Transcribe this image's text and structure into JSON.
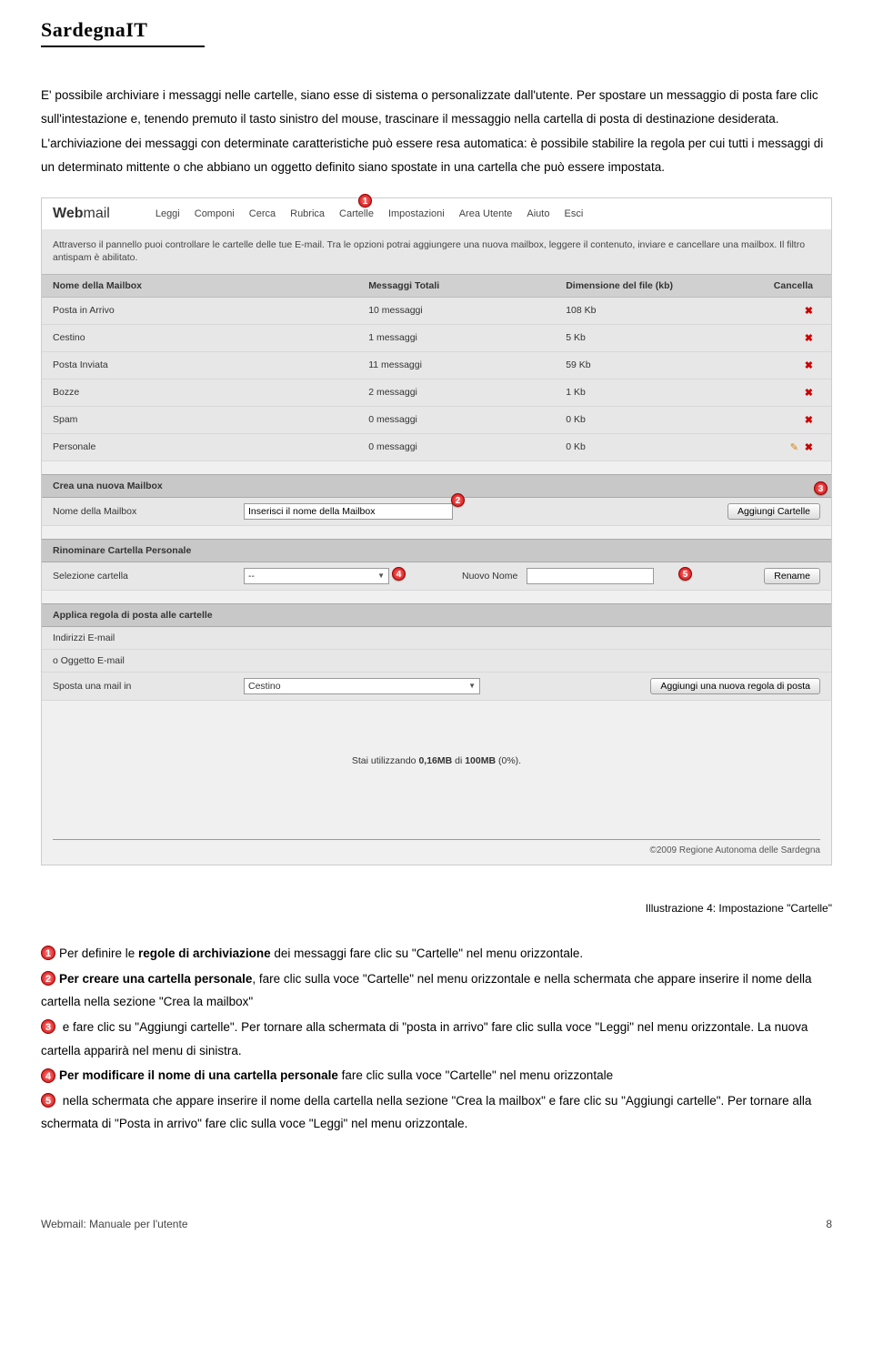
{
  "logo": {
    "brand": "Sardegna",
    "suffix": "IT"
  },
  "intro_paragraphs": [
    "E' possibile archiviare i messaggi nelle cartelle, siano esse di sistema o personalizzate dall'utente. Per spostare un messaggio di posta fare clic sull'intestazione e, tenendo premuto il tasto sinistro del mouse, trascinare il messaggio nella cartella di posta di destinazione desiderata.",
    "L'archiviazione dei messaggi con determinate caratteristiche può essere resa automatica: è possibile stabilire la regola per cui tutti i messaggi di un determinato mittente o che abbiano un oggetto definito siano spostate in una cartella che può essere impostata."
  ],
  "webmail": {
    "brand_bold": "Web",
    "brand_light": "mail",
    "nav": [
      "Leggi",
      "Componi",
      "Cerca",
      "Rubrica",
      "Cartelle",
      "Impostazioni",
      "Area Utente",
      "Aiuto",
      "Esci"
    ],
    "intro": "Attraverso il pannello puoi controllare le cartelle delle tue E-mail. Tra le opzioni potrai aggiungere una nuova mailbox, leggere il contenuto, inviare e cancellare una mailbox. Il filtro antispam è abilitato.",
    "table_headers": [
      "Nome della Mailbox",
      "Messaggi Totali",
      "Dimensione del file (kb)",
      "Cancella"
    ],
    "rows": [
      {
        "name": "Posta in Arrivo",
        "msgs": "10 messaggi",
        "size": "108 Kb",
        "editable": false
      },
      {
        "name": "Cestino",
        "msgs": "1 messaggi",
        "size": "5 Kb",
        "editable": false
      },
      {
        "name": "Posta Inviata",
        "msgs": "11 messaggi",
        "size": "59 Kb",
        "editable": false
      },
      {
        "name": "Bozze",
        "msgs": "2 messaggi",
        "size": "1 Kb",
        "editable": false
      },
      {
        "name": "Spam",
        "msgs": "0 messaggi",
        "size": "0 Kb",
        "editable": false
      },
      {
        "name": "Personale",
        "msgs": "0 messaggi",
        "size": "0 Kb",
        "editable": true
      }
    ],
    "section_create": "Crea una nuova Mailbox",
    "create_label": "Nome della Mailbox",
    "create_placeholder": "Inserisci il nome della Mailbox",
    "create_button": "Aggiungi Cartelle",
    "section_rename": "Rinominare Cartella Personale",
    "rename_sel_label": "Selezione cartella",
    "rename_sel_value": "--",
    "rename_new_label": "Nuovo Nome",
    "rename_button": "Rename",
    "section_rule": "Applica regola di posta alle cartelle",
    "rule_addr_label": "Indirizzi E-mail",
    "rule_subj_label": "o Oggetto E-mail",
    "rule_move_label": "Sposta una mail in",
    "rule_move_value": "Cestino",
    "rule_button": "Aggiungi una nuova regola di posta",
    "usage_prefix": "Stai utilizzando ",
    "usage_bold": "0,16MB",
    "usage_mid": " di ",
    "usage_bold2": "100MB",
    "usage_suffix": " (0%).",
    "copyright": "©2009 Regione Autonoma delle Sardegna"
  },
  "illustration_caption": "Illustrazione 4: Impostazione \"Cartelle\"",
  "steps": {
    "p1_prefix": "Per definire le ",
    "p1_bold": "regole di archiviazione",
    "p1_suffix": " dei messaggi fare clic su \"Cartelle\" nel menu orizzontale.",
    "p2_bold": "Per creare una cartella personale",
    "p2_suffix": ", fare clic sulla voce \"Cartelle\" nel menu orizzontale e nella schermata che appare inserire il nome della cartella nella sezione \"Crea la mailbox\"",
    "p3": " e fare clic su \"Aggiungi cartelle\". Per tornare alla schermata di \"posta in arrivo\" fare clic sulla voce \"Leggi\" nel menu orizzontale. La nuova cartella apparirà nel menu di sinistra.",
    "p4_bold": "Per modificare il nome di una cartella personale",
    "p4_suffix": " fare clic sulla voce \"Cartelle\" nel menu orizzontale",
    "p5": " nella schermata che appare inserire il nome della cartella nella sezione \"Crea la mailbox\" e fare clic su \"Aggiungi cartelle\". Per tornare alla schermata di \"Posta in arrivo\" fare clic sulla voce \"Leggi\" nel menu orizzontale."
  },
  "footer": {
    "left": "Webmail: Manuale per l'utente",
    "right": "8"
  }
}
